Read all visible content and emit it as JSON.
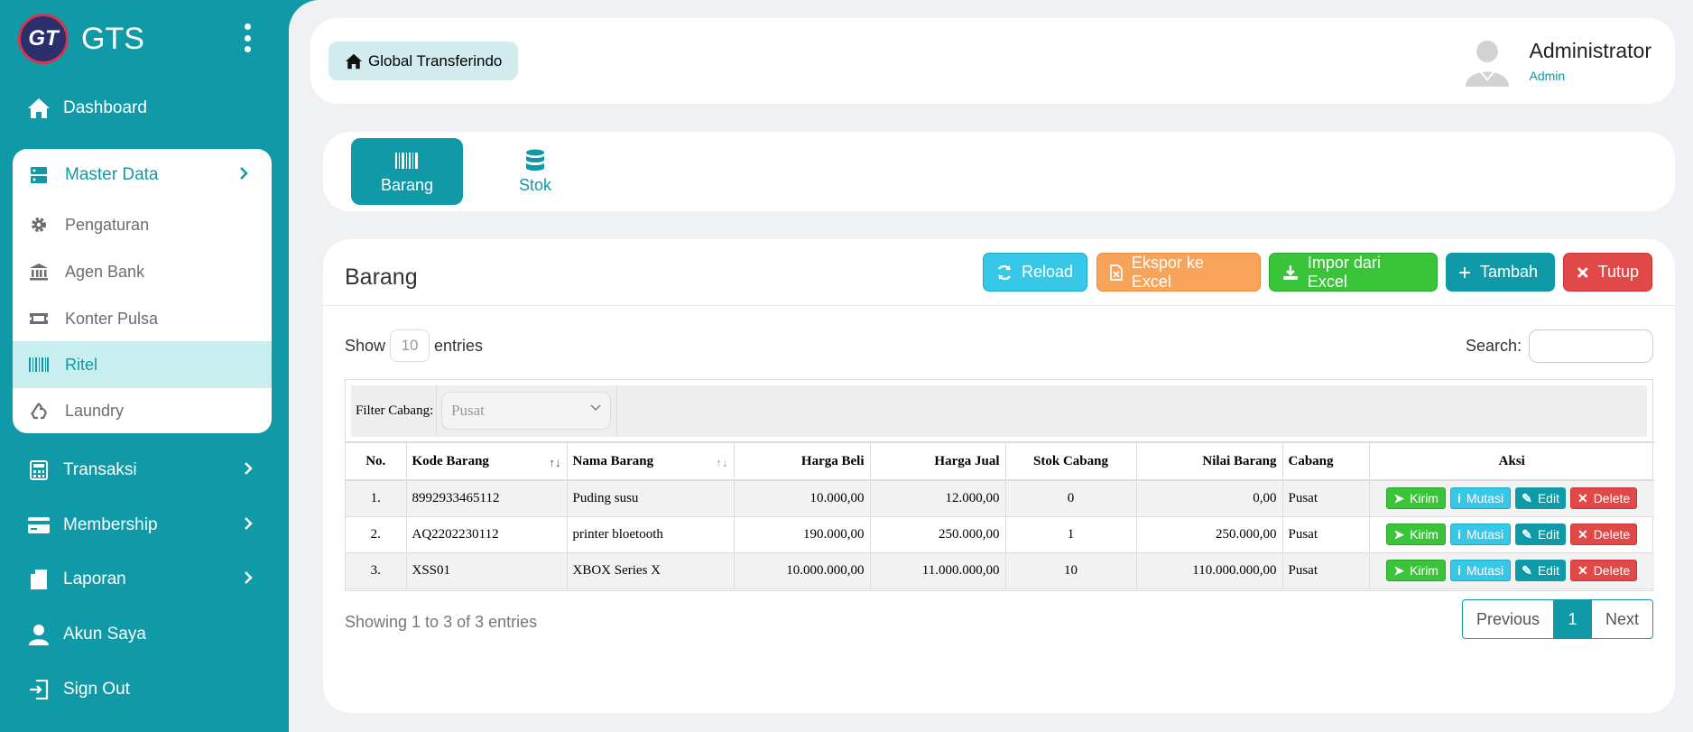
{
  "brand": {
    "logo_text": "GT",
    "name": "GTS"
  },
  "sidebar": {
    "dashboard": "Dashboard",
    "master_data": {
      "label": "Master Data",
      "items": [
        {
          "label": "Pengaturan",
          "icon": "gear-icon"
        },
        {
          "label": "Agen Bank",
          "icon": "bank-icon"
        },
        {
          "label": "Konter Pulsa",
          "icon": "ticket-icon"
        },
        {
          "label": "Ritel",
          "icon": "barcode-icon",
          "active": true
        },
        {
          "label": "Laundry",
          "icon": "recycle-icon"
        }
      ]
    },
    "transaksi": "Transaksi",
    "membership": "Membership",
    "laporan": "Laporan",
    "akun_saya": "Akun Saya",
    "sign_out": "Sign Out"
  },
  "header": {
    "breadcrumb": "Global Transferindo",
    "user_name": "Administrator",
    "user_role": "Admin"
  },
  "tabs": [
    {
      "label": "Barang",
      "active": true
    },
    {
      "label": "Stok",
      "active": false
    }
  ],
  "card": {
    "title": "Barang",
    "buttons": {
      "reload": "Reload",
      "export": "Ekspor ke Excel",
      "import": "Impor dari Excel",
      "add": "Tambah",
      "close": "Tutup"
    },
    "show_label": "Show",
    "entries_value": "10",
    "entries_label": "entries",
    "search_label": "Search:",
    "filter": {
      "label": "Filter Cabang:",
      "value": "Pusat"
    },
    "columns": [
      "No.",
      "Kode Barang",
      "Nama Barang",
      "Harga Beli",
      "Harga Jual",
      "Stok Cabang",
      "Nilai Barang",
      "Cabang",
      "Aksi"
    ],
    "rows": [
      {
        "no": "1.",
        "kode": "8992933465112",
        "nama": "Puding susu",
        "beli": "10.000,00",
        "jual": "12.000,00",
        "stok": "0",
        "nilai": "0,00",
        "cabang": "Pusat"
      },
      {
        "no": "2.",
        "kode": "AQ2202230112",
        "nama": "printer bloetooth",
        "beli": "190.000,00",
        "jual": "250.000,00",
        "stok": "1",
        "nilai": "250.000,00",
        "cabang": "Pusat"
      },
      {
        "no": "3.",
        "kode": "XSS01",
        "nama": "XBOX Series X",
        "beli": "10.000.000,00",
        "jual": "11.000.000,00",
        "stok": "10",
        "nilai": "110.000.000,00",
        "cabang": "Pusat"
      }
    ],
    "actions": {
      "kirim": "Kirim",
      "mutasi": "Mutasi",
      "edit": "Edit",
      "delete": "Delete"
    },
    "info": "Showing 1 to 3 of 3 entries",
    "pagination": {
      "previous": "Previous",
      "current": "1",
      "next": "Next"
    }
  },
  "colors": {
    "primary": "#109aa7",
    "background": "#eff1f3",
    "success": "#3ac43a",
    "info": "#37c8e8",
    "warning": "#f7a45a",
    "danger": "#e14848"
  }
}
